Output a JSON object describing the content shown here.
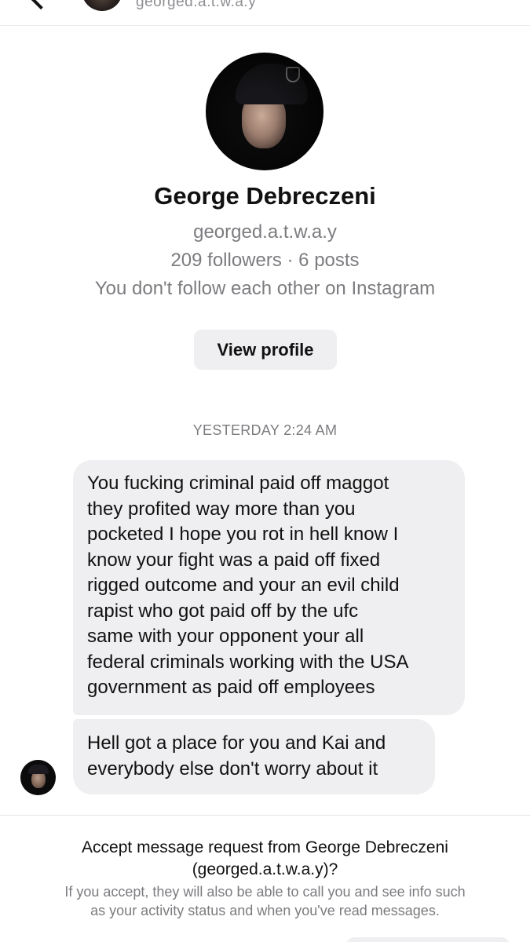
{
  "header": {
    "username": "georged.a.t.w.a.y"
  },
  "profile": {
    "name": "George Debreczeni",
    "username": "georged.a.t.w.a.y",
    "stats": "209 followers · 6 posts",
    "follow_status": "You don't follow each other on Instagram",
    "view_profile_label": "View profile"
  },
  "thread": {
    "timestamp": "YESTERDAY 2:24 AM",
    "messages": [
      {
        "lines": [
          "You fucking criminal paid off maggot",
          "they profited way more than you",
          "pocketed I hope you rot in hell know I",
          "know your fight was a paid off fixed",
          "rigged outcome and your an evil child",
          "rapist who got paid off by the ufc",
          "same with your opponent your all",
          "federal criminals working with the USA",
          "government as paid off employees"
        ]
      },
      {
        "lines": [
          "Hell got a place for you and Kai and",
          "everybody else don't worry about it"
        ]
      }
    ]
  },
  "request": {
    "title_line1": "Accept message request from George Debreczeni",
    "title_line2": "(georged.a.t.w.a.y)?",
    "info_line1": "If you accept, they will also be able to call you and see info such",
    "info_line2": "as your activity status and when you've read messages."
  },
  "icons": {
    "back": "chevron-left-icon"
  }
}
